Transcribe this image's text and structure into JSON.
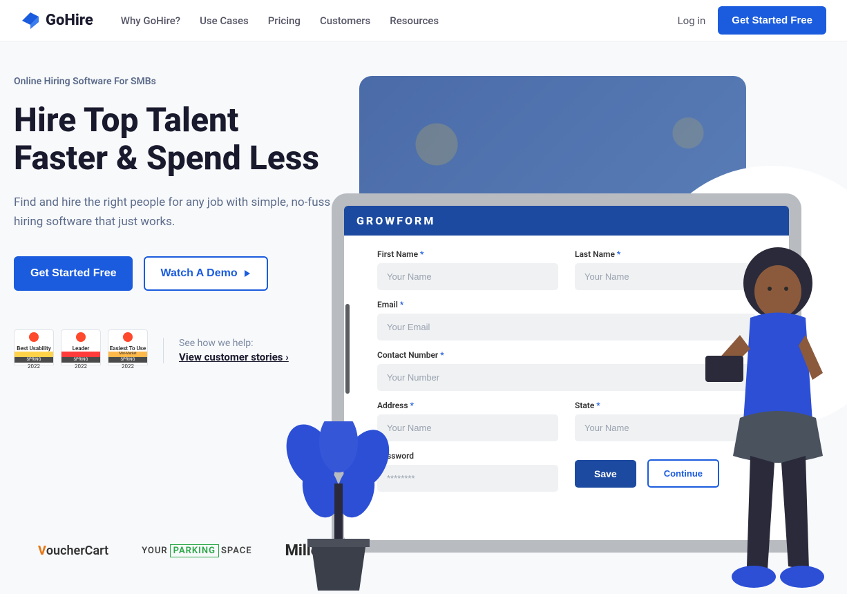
{
  "brand": "GoHire",
  "nav": {
    "why": "Why GoHire?",
    "use": "Use Cases",
    "pricing": "Pricing",
    "customers": "Customers",
    "resources": "Resources"
  },
  "header": {
    "login": "Log in",
    "cta": "Get Started Free"
  },
  "hero": {
    "eyebrow": "Online Hiring Software For SMBs",
    "title": "Hire Top Talent Faster & Spend Less",
    "subtitle": "Find and hire the right people for any job with simple, no-fuss hiring software that just works.",
    "cta_primary": "Get Started Free",
    "cta_secondary": "Watch A Demo"
  },
  "social": {
    "label": "See how we help:",
    "link": "View customer stories",
    "badges": [
      {
        "title": "Best Usability",
        "strip": "#ffd24a",
        "label": "SPRING",
        "year": "2022"
      },
      {
        "title": "Leader",
        "strip": "#ff3b3b",
        "label": "SPRING",
        "year": "2022"
      },
      {
        "title": "Easiest To Use",
        "strip": "#ffb84a",
        "label": "Mid-Market",
        "year": "2022"
      }
    ]
  },
  "form": {
    "brand": "GROWFORM",
    "first_name": {
      "label": "First Name",
      "placeholder": "Your Name"
    },
    "last_name": {
      "label": "Last Name",
      "placeholder": "Your Name"
    },
    "email": {
      "label": "Email",
      "placeholder": "Your Email"
    },
    "contact": {
      "label": "Contact Number",
      "placeholder": "Your Number"
    },
    "address": {
      "label": "Address",
      "placeholder": "Your Name"
    },
    "state": {
      "label": "State",
      "placeholder": "Your Name"
    },
    "password": {
      "label": "Password",
      "placeholder": "********"
    },
    "save": "Save",
    "continue": "Continue"
  },
  "logos": {
    "vc": "oucherCart",
    "yps_your": "YOUR",
    "yps_park": "PARKING",
    "yps_space": "SPACE",
    "mill": "MillerIn"
  }
}
